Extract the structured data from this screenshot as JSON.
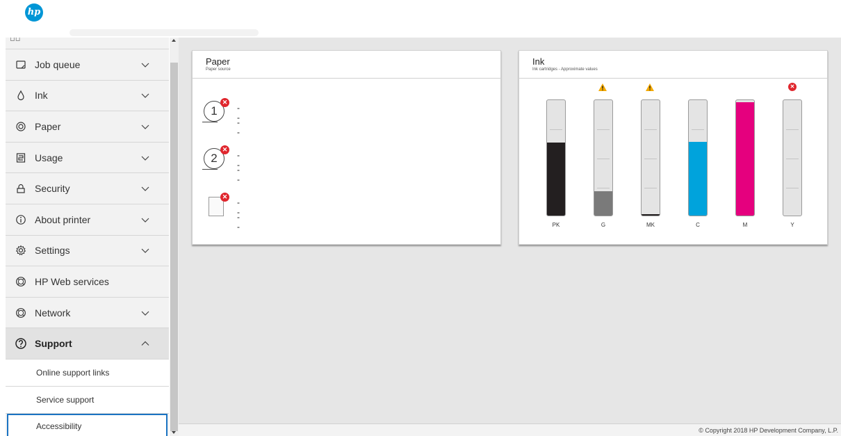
{
  "header": {
    "logo_text": "hp",
    "logo_color": "#0096d6"
  },
  "sidebar": {
    "items": [
      {
        "label": "Job queue",
        "icon": "job-queue-icon",
        "expandable": true
      },
      {
        "label": "Ink",
        "icon": "ink-drop-icon",
        "expandable": true
      },
      {
        "label": "Paper",
        "icon": "paper-roll-icon",
        "expandable": true
      },
      {
        "label": "Usage",
        "icon": "usage-icon",
        "expandable": true
      },
      {
        "label": "Security",
        "icon": "lock-icon",
        "expandable": true
      },
      {
        "label": "About printer",
        "icon": "info-icon",
        "expandable": true
      },
      {
        "label": "Settings",
        "icon": "gear-icon",
        "expandable": true
      },
      {
        "label": "HP Web services",
        "icon": "globe-icon",
        "expandable": false
      },
      {
        "label": "Network",
        "icon": "globe-icon",
        "expandable": true
      },
      {
        "label": "Support",
        "icon": "help-icon",
        "expandable": true,
        "expanded": true
      }
    ],
    "support_subitems": [
      {
        "label": "Online support links"
      },
      {
        "label": "Service support"
      },
      {
        "label": "Accessibility",
        "focused": true
      }
    ]
  },
  "paper_card": {
    "title": "Paper",
    "subtitle": "Paper source",
    "trays": [
      {
        "number": "1",
        "type": "roll",
        "status": "error",
        "line1": "--",
        "line2": "--"
      },
      {
        "number": "2",
        "type": "roll",
        "status": "error",
        "line1": "--",
        "line2": "--"
      },
      {
        "number": "",
        "type": "sheet",
        "status": "error",
        "line1": "--",
        "line2": "--"
      }
    ]
  },
  "ink_card": {
    "title": "Ink",
    "subtitle": "Ink cartridges - Approximate values",
    "cartridges": [
      {
        "label": "PK",
        "color": "#231f20",
        "level": 0.63,
        "status": ""
      },
      {
        "label": "G",
        "color": "#7a7a7a",
        "level": 0.21,
        "status": "warning"
      },
      {
        "label": "MK",
        "color": "#231f20",
        "level": 0.01,
        "status": "warning"
      },
      {
        "label": "C",
        "color": "#00a3dc",
        "level": 0.64,
        "status": ""
      },
      {
        "label": "M",
        "color": "#e5007e",
        "level": 0.98,
        "status": ""
      },
      {
        "label": "Y",
        "color": "#ffe600",
        "level": 0.0,
        "status": "error"
      }
    ]
  },
  "status_colors": {
    "error": "#e0262d",
    "warning": "#f4a900"
  },
  "footer": {
    "copyright": "© Copyright 2018 HP Development Company, L.P."
  }
}
